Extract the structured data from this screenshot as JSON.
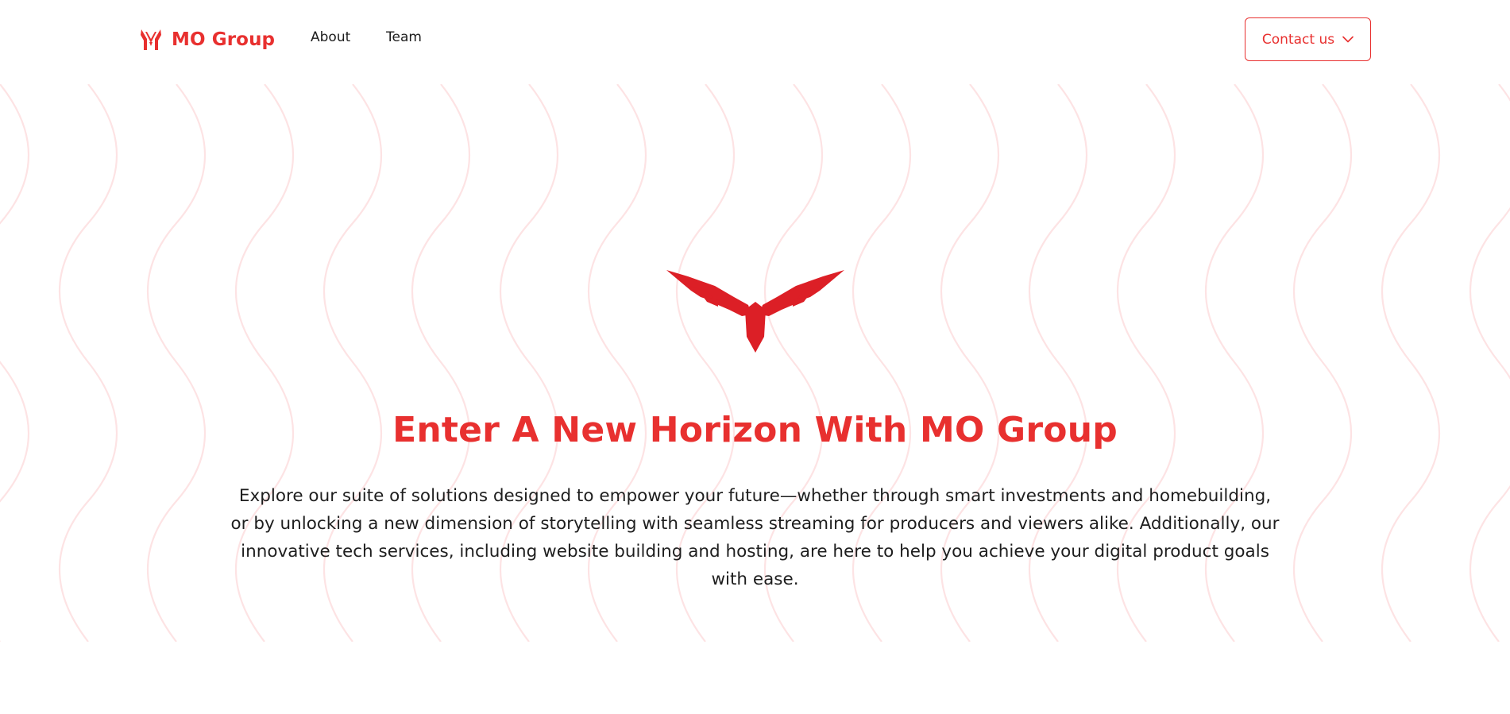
{
  "header": {
    "brand_name": "MO Group",
    "brand_icon": "mo-logo-icon",
    "nav": [
      {
        "label": "About"
      },
      {
        "label": "Team"
      }
    ],
    "contact": {
      "label": "Contact us",
      "icon": "chevron-down-icon"
    }
  },
  "hero": {
    "emblem_icon": "winged-emblem-icon",
    "title": "Enter A New Horizon With MO Group",
    "description": "Explore our suite of solutions designed to empower your future—whether through smart investments and homebuilding, or by unlocking a new dimension of storytelling with seamless streaming for producers and viewers alike. Additionally, our innovative tech services, including website building and hosting, are here to help you achieve your digital product goals with ease."
  },
  "colors": {
    "accent": "#e8302f",
    "emblem": "#dc1f26",
    "wave_pattern": "#fde6e6",
    "text": "#1e1e1e",
    "background": "#ffffff"
  }
}
